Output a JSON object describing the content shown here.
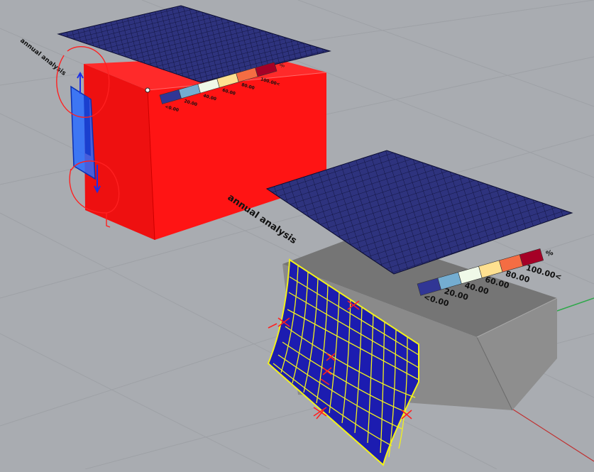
{
  "viewport": {
    "colors": {
      "background": "#a9acb1",
      "grid_line": "#9da0a5",
      "box_red": "#ff1414",
      "box_gray": "#8c8c8c",
      "panel_blue": "#2a2f7a",
      "panel_mesh": "#0c0f3a",
      "curved_surface": "#1a1aa8",
      "selection_yellow": "#f2f21a",
      "gizmo_blue": "#2a6cff",
      "markup_red": "#ff1e1e"
    }
  },
  "labels": {
    "analysis_small": "annual analysis",
    "analysis_large": "annual analysis"
  },
  "legend_small": {
    "unit": "%",
    "ticks": [
      "<0.00",
      "20.00",
      "40.00",
      "60.00",
      "80.00",
      "100.00<"
    ],
    "swatches": [
      "#313695",
      "#74add1",
      "#f0f9e8",
      "#fee090",
      "#f46d43",
      "#a50026"
    ]
  },
  "legend_large": {
    "unit": "%",
    "ticks": [
      "<0.00",
      "20.00",
      "40.00",
      "60.00",
      "80.00",
      "100.00<"
    ],
    "swatches": [
      "#313695",
      "#74add1",
      "#f0f9e8",
      "#fee090",
      "#f46d43",
      "#a50026"
    ]
  }
}
